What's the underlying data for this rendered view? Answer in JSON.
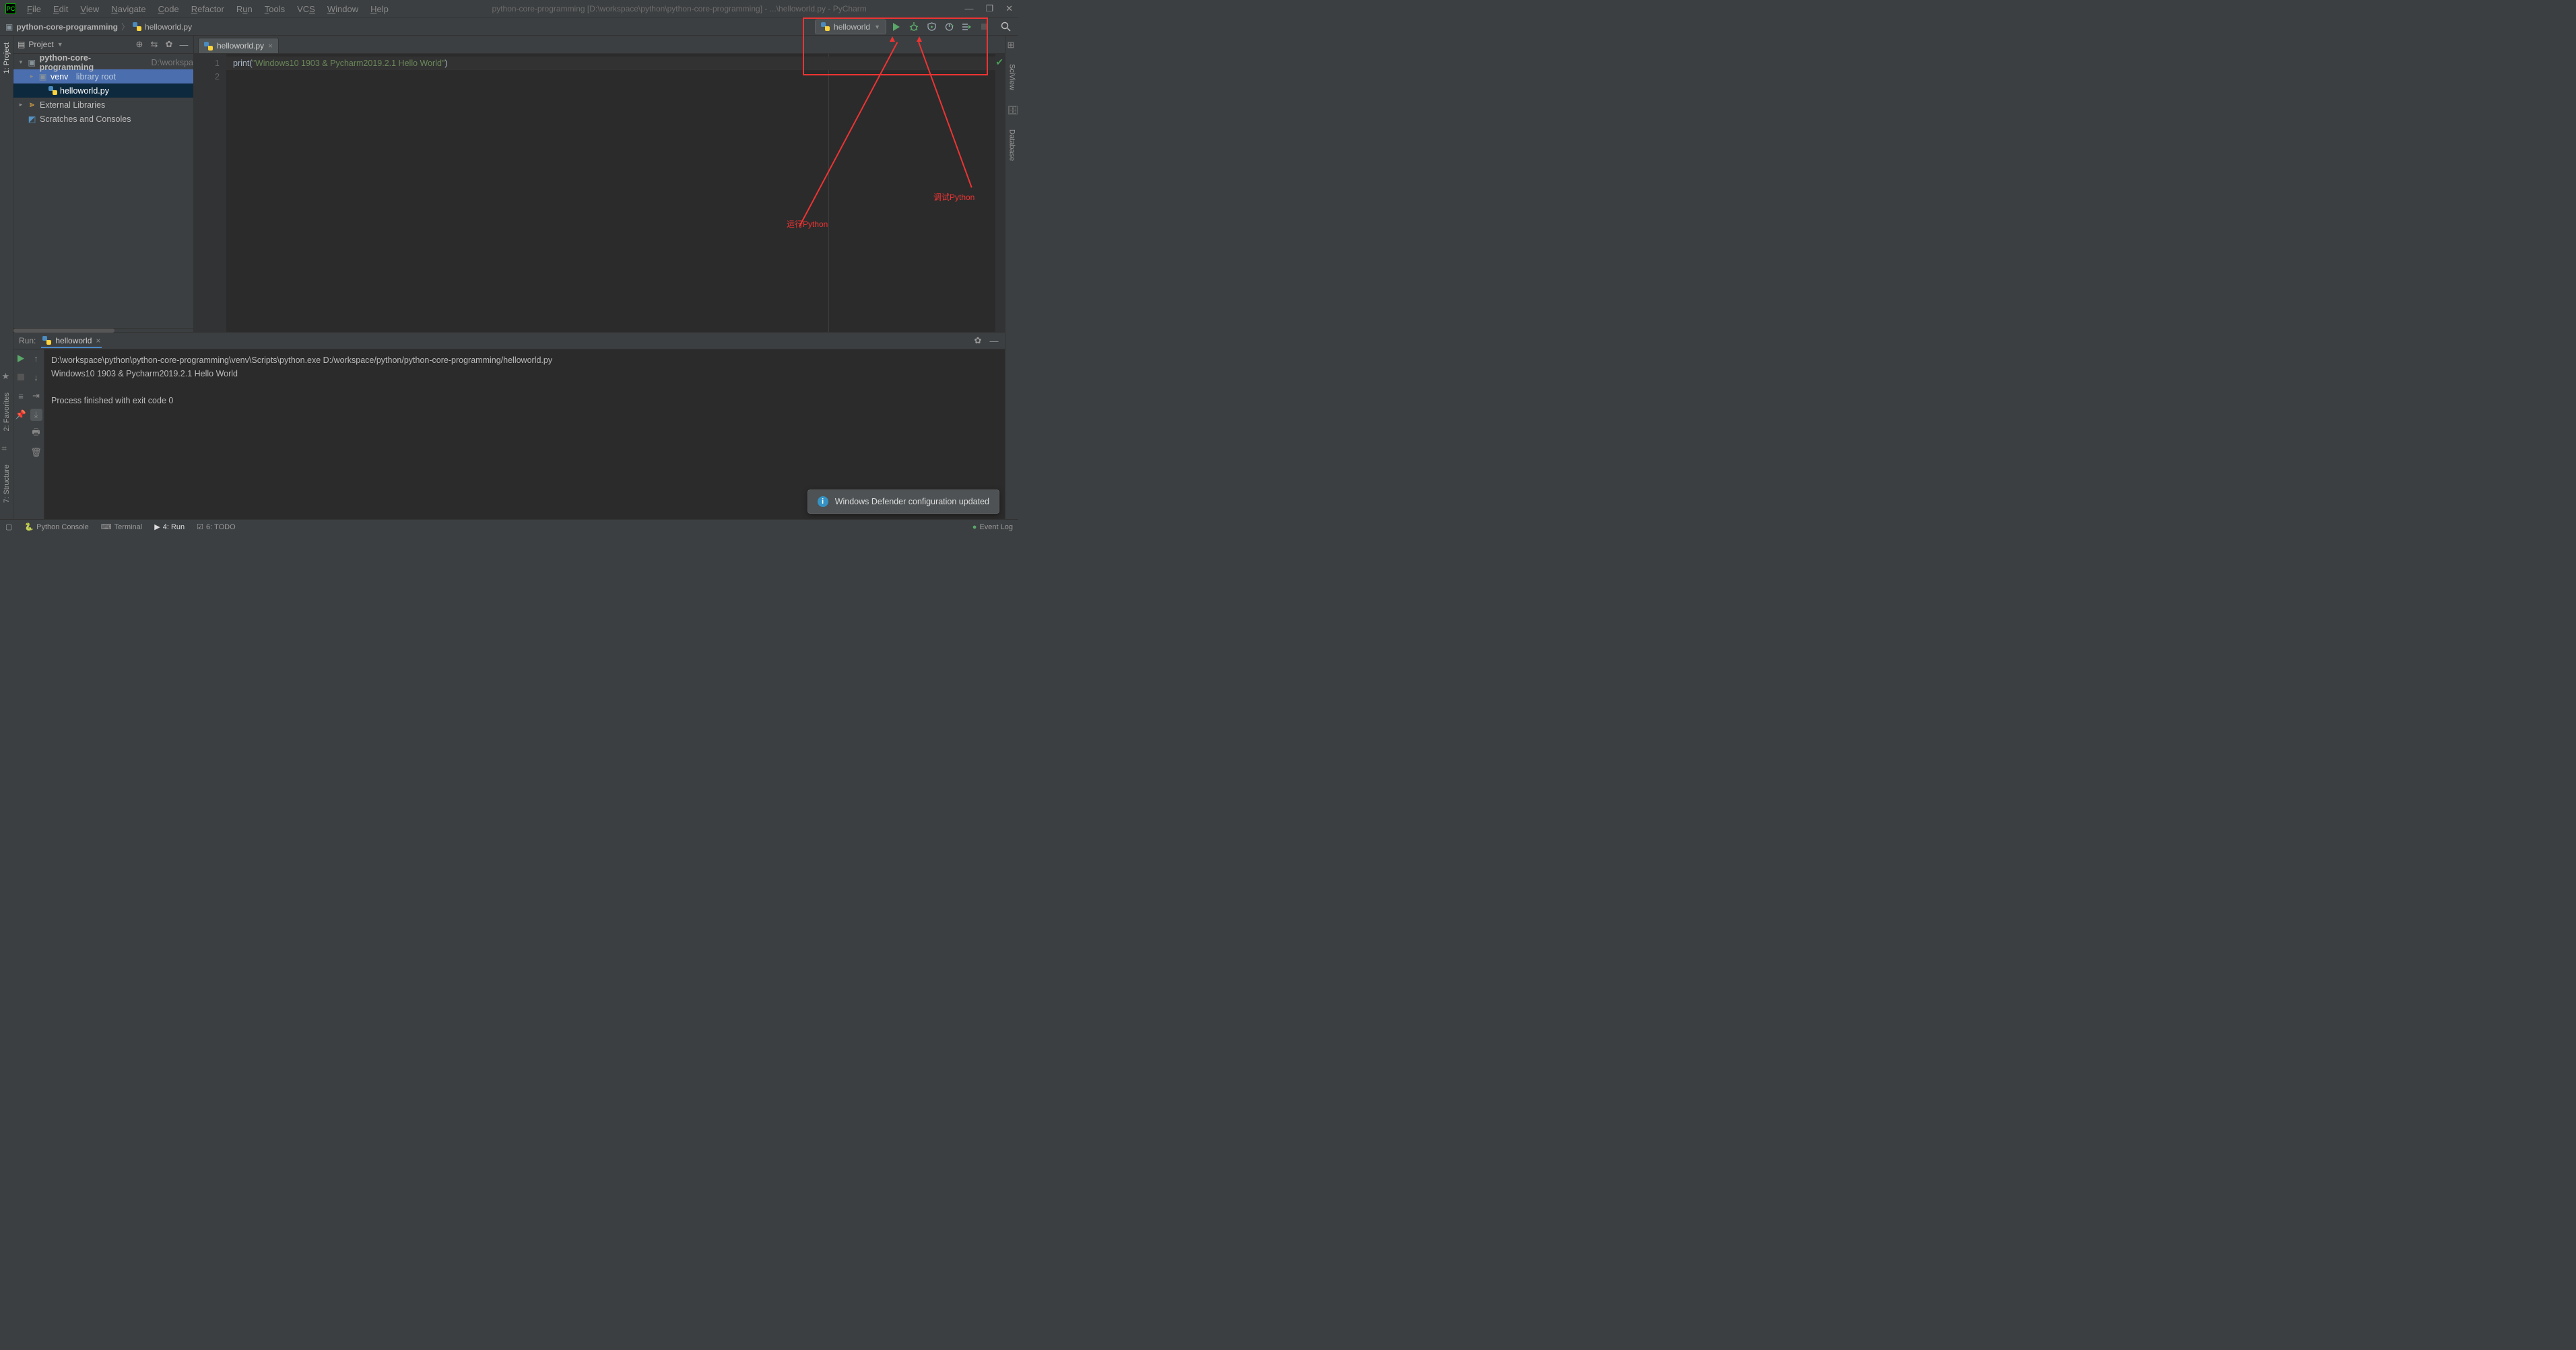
{
  "title": "python-core-programming [D:\\workspace\\python\\python-core-programming] - ...\\helloworld.py - PyCharm",
  "menus": [
    "File",
    "Edit",
    "View",
    "Navigate",
    "Code",
    "Refactor",
    "Run",
    "Tools",
    "VCS",
    "Window",
    "Help"
  ],
  "breadcrumb": {
    "root": "python-core-programming",
    "file": "helloworld.py"
  },
  "run_config": "helloworld",
  "project": {
    "title": "Project",
    "root": "python-core-programming",
    "root_path": "D:\\workspa",
    "venv": "venv",
    "venv_hint": "library root",
    "file": "helloworld.py",
    "ext": "External Libraries",
    "scratch": "Scratches and Consoles"
  },
  "editor": {
    "tab": "helloworld.py",
    "lines": [
      "1",
      "2"
    ],
    "code_kw": "print",
    "code_str": "\"Windows10 1903 & Pycharm2019.2.1 Hello World\""
  },
  "run": {
    "label": "Run:",
    "tab": "helloworld",
    "lines": [
      "D:\\workspace\\python\\python-core-programming\\venv\\Scripts\\python.exe D:/workspace/python/python-core-programming/helloworld.py",
      "Windows10 1903 & Pycharm2019.2.1 Hello World",
      "",
      "Process finished with exit code 0"
    ]
  },
  "status": {
    "items": [
      "Python Console",
      "Terminal",
      "4: Run",
      "6: TODO"
    ],
    "right": "Event Log"
  },
  "notif": "Windows Defender configuration updated",
  "left_tabs": [
    "2: Favorites",
    "7: Structure"
  ],
  "left_top": "1: Project",
  "right_tabs": [
    "SciView",
    "Database"
  ],
  "annot": {
    "run": "运行Python",
    "debug": "调试Python"
  }
}
